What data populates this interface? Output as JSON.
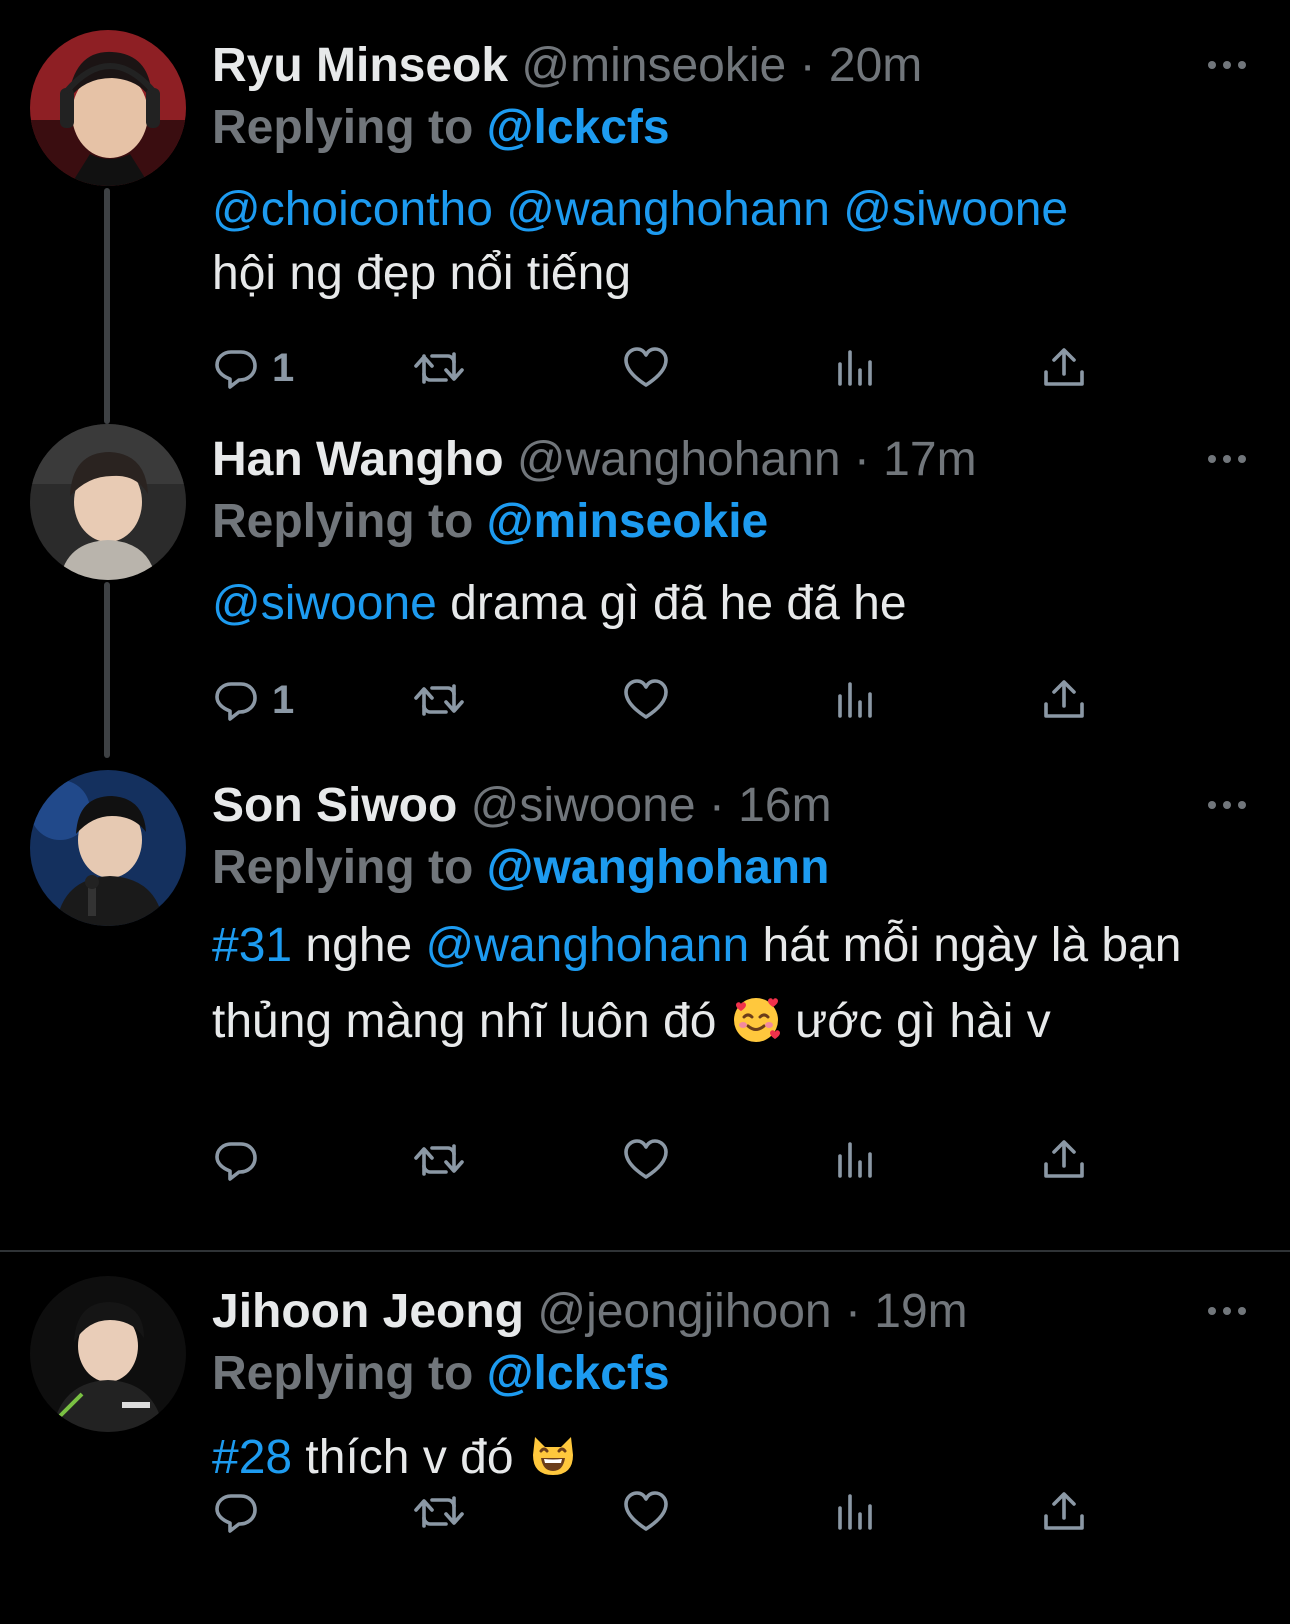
{
  "tweets": [
    {
      "name": "Ryu Minseok",
      "handle": "@minseokie",
      "sep": " · ",
      "time": "20m",
      "replying_label": "Replying to ",
      "replying_to": "@lckcfs",
      "text_parts": {
        "m1": "@choicontho",
        "m2": "@wanghohann",
        "m3": "@siwoone",
        "body": "hội ng đẹp nổi tiếng"
      },
      "reply_count": "1"
    },
    {
      "name": "Han Wangho",
      "handle": "@wanghohann",
      "sep": " · ",
      "time": "17m",
      "replying_label": "Replying to ",
      "replying_to": "@minseokie",
      "text_parts": {
        "m1": "@siwoone",
        "body": " drama gì đã he đã he"
      },
      "reply_count": "1"
    },
    {
      "name": "Son Siwoo",
      "handle": "@siwoone",
      "sep": " · ",
      "time": "16m",
      "replying_label": "Replying to ",
      "replying_to": "@wanghohann",
      "text_parts": {
        "tag": "#31",
        "a": " nghe ",
        "m1": "@wanghohann",
        "b": " hát mỗi ngày là bạn thủng màng nhĩ luôn đó ",
        "c": "  ước gì hài v"
      },
      "reply_count": ""
    },
    {
      "name": "Jihoon Jeong",
      "handle": "@jeongjihoon",
      "sep": " · ",
      "time": "19m",
      "replying_label": "Replying to ",
      "replying_to": "@lckcfs",
      "text_parts": {
        "tag": "#28",
        "a": " thích v đó "
      },
      "reply_count": ""
    }
  ],
  "icons": {
    "reply": "reply-icon",
    "retweet": "retweet-icon",
    "like": "heart-icon",
    "views": "analytics-icon",
    "share": "share-icon",
    "more": "more-icon"
  },
  "colors": {
    "background": "#000000",
    "text": "#e7e9ea",
    "secondary": "#71767b",
    "link": "#1d9bf0",
    "thread_line": "#3e4144"
  }
}
